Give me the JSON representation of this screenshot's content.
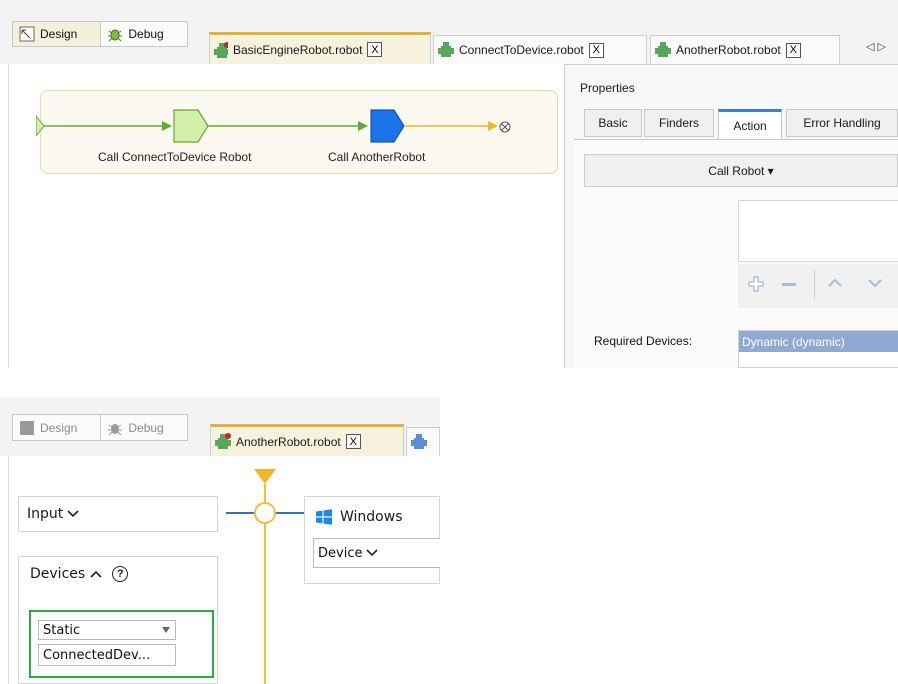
{
  "top": {
    "modes": {
      "design": "Design",
      "debug": "Debug"
    },
    "tabs": [
      {
        "label": "BasicEngineRobot.robot",
        "close": "X"
      },
      {
        "label": "ConnectToDevice.robot",
        "close": "X"
      },
      {
        "label": "AnotherRobot.robot",
        "close": "X"
      }
    ],
    "scroll_arrows": "◁ ▷",
    "flow": {
      "step1": "Call ConnectToDevice Robot",
      "step2": "Call AnotherRobot",
      "end_symbol": "⊗"
    },
    "properties": {
      "title": "Properties",
      "tabs": [
        "Basic",
        "Finders",
        "Action",
        "Error Handling"
      ],
      "selected_tab": "Action",
      "call_robot": "Call Robot ▾",
      "required_devices_label": "Required Devices:",
      "required_devices_selected": "Dynamic (dynamic)"
    }
  },
  "bottom": {
    "modes": {
      "design": "Design",
      "debug": "Debug"
    },
    "tab": {
      "label": "AnotherRobot.robot",
      "close": "X"
    },
    "input_label": "Input",
    "devices_label": "Devices",
    "help_icon": "?",
    "static_select": "Static",
    "connected_value": "ConnectedDev...",
    "windows_label": "Windows",
    "device_label": "Device"
  },
  "colors": {
    "flow_green": "#66a834",
    "flow_orange": "#f2b628",
    "node_green": "#d2f0a9",
    "node_blue": "#1a73e8",
    "highlight_green": "#2aae3c",
    "bottom_line": "#f0bf3a"
  }
}
